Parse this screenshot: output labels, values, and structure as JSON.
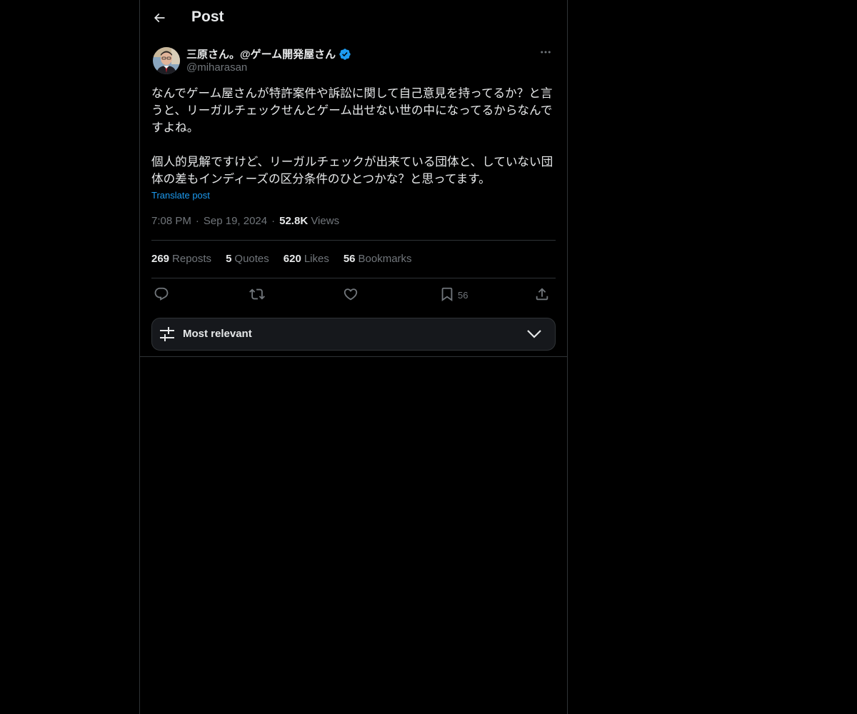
{
  "header": {
    "title": "Post",
    "back_icon": "arrow-left-icon"
  },
  "author": {
    "display_name": "三原さん。@ゲーム開発屋さん",
    "handle": "@miharasan",
    "verified": true,
    "verified_color": "#1d9bf0"
  },
  "post": {
    "text": "なんでゲーム屋さんが特許案件や訴訟に関して自己意見を持ってるか？と言うと、リーガルチェックせんとゲーム出せない世の中になってるからなんですよね。\n\n個人的見解ですけど、リーガルチェックが出来ている団体と、していない団体の差もインディーズの区分条件のひとつかな？と思ってます。",
    "translate_label": "Translate post",
    "time": "7:08 PM",
    "separator": "·",
    "date": "Sep 19, 2024",
    "views_count": "52.8K",
    "views_label": "Views"
  },
  "stats": {
    "reposts_count": "269",
    "reposts_label": "Reposts",
    "quotes_count": "5",
    "quotes_label": "Quotes",
    "likes_count": "620",
    "likes_label": "Likes",
    "bookmarks_count": "56",
    "bookmarks_label": "Bookmarks"
  },
  "actions": {
    "reply_icon": "reply-icon",
    "repost_icon": "repost-icon",
    "like_icon": "heart-icon",
    "bookmark_icon": "bookmark-icon",
    "bookmark_count": "56",
    "share_icon": "share-icon"
  },
  "sort": {
    "label": "Most relevant",
    "icon": "sliders-icon",
    "chevron": "chevron-down-icon"
  },
  "colors": {
    "background": "#000000",
    "text": "#e7e9ea",
    "muted": "#71767b",
    "accent": "#1d9bf0",
    "border": "#2f3336"
  }
}
